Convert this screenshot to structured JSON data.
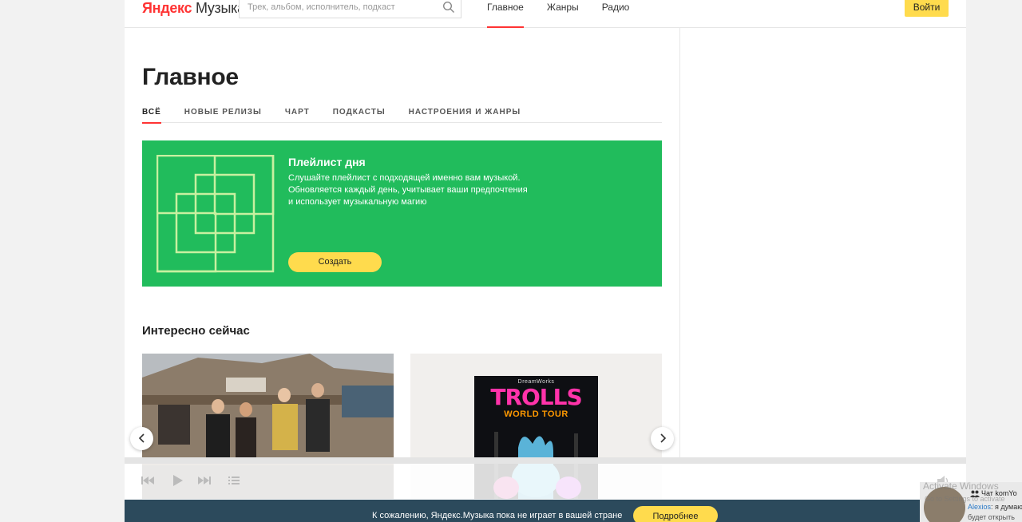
{
  "header": {
    "logo_brand": "Яндекс",
    "logo_product": "Музыка",
    "search_placeholder": "Трек, альбом, исполнитель, подкаст",
    "nav": [
      {
        "label": "Главное",
        "active": true
      },
      {
        "label": "Жанры",
        "active": false
      },
      {
        "label": "Радио",
        "active": false
      }
    ],
    "login_label": "Войти"
  },
  "main": {
    "title": "Главное",
    "tabs": [
      {
        "label": "ВСЁ",
        "active": true
      },
      {
        "label": "НОВЫЕ РЕЛИЗЫ",
        "active": false
      },
      {
        "label": "ЧАРТ",
        "active": false
      },
      {
        "label": "ПОДКАСТЫ",
        "active": false
      },
      {
        "label": "НАСТРОЕНИЯ И ЖАНРЫ",
        "active": false
      }
    ],
    "promo": {
      "title": "Плейлист дня",
      "desc_line1": "Слушайте плейлист с подходящей именно вам музыкой.",
      "desc_line2": "Обновляется каждый день, учитывает ваши предпочтения",
      "desc_line3": "и использует музыкальную магию",
      "button": "Создать",
      "color": "#21bc5c"
    },
    "section_title": "Интересно сейчас",
    "poster": {
      "brand": "DreamWorks",
      "title": "TROLLS",
      "subtitle": "WORLD TOUR"
    }
  },
  "banner": {
    "message": "К сожалению, Яндекс.Музыка пока не играет в вашей стране",
    "button": "Подробнее"
  },
  "chat": {
    "title": "Чат komYo",
    "user": "Alexios",
    "message": "я думаю",
    "line2": "будет открыть"
  },
  "os_overlay": {
    "watermark_title": "Activate Windows",
    "watermark_sub": "Go to Settings to activate"
  },
  "colors": {
    "accent_red": "#ff3333",
    "yellow": "#ffdb4d",
    "banner_bg": "#2c4a5c"
  }
}
